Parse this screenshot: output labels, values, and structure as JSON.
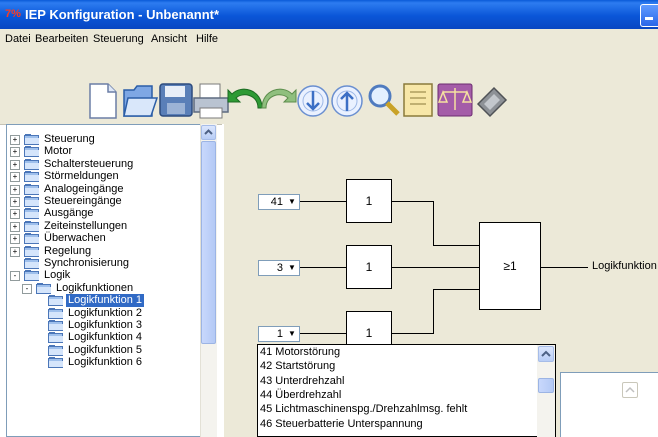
{
  "window": {
    "title": "IEP Konfiguration - Unbenannt*",
    "app_icon_text": "7%",
    "colors": {
      "titlebar": "#0a56d8",
      "selection": "#316ac5",
      "workspace": "#ece9d8"
    }
  },
  "menubar": {
    "items": [
      "Datei",
      "Bearbeiten",
      "Steuerung",
      "Ansicht",
      "Hilfe"
    ]
  },
  "toolbar": {
    "buttons": [
      {
        "icon": "new-document-icon"
      },
      {
        "icon": "open-folder-icon"
      },
      {
        "icon": "save-disk-icon"
      },
      {
        "icon": "print-icon"
      },
      {
        "icon": "undo-arrow-icon"
      },
      {
        "icon": "redo-arrow-icon"
      },
      {
        "icon": "download-arrow-icon"
      },
      {
        "icon": "upload-arrow-icon"
      },
      {
        "icon": "search-magnifier-icon"
      },
      {
        "icon": "notebook-icon"
      },
      {
        "icon": "scales-icon"
      },
      {
        "icon": "device-icon"
      }
    ]
  },
  "tree": {
    "items": [
      {
        "label": "Steuerung",
        "level": 0,
        "expander": "+"
      },
      {
        "label": "Motor",
        "level": 0,
        "expander": "+"
      },
      {
        "label": "Schaltersteuerung",
        "level": 0,
        "expander": "+"
      },
      {
        "label": "Störmeldungen",
        "level": 0,
        "expander": "+"
      },
      {
        "label": "Analogeingänge",
        "level": 0,
        "expander": "+"
      },
      {
        "label": "Steuereingänge",
        "level": 0,
        "expander": "+"
      },
      {
        "label": "Ausgänge",
        "level": 0,
        "expander": "+"
      },
      {
        "label": "Zeiteinstellungen",
        "level": 0,
        "expander": "+"
      },
      {
        "label": "Überwachen",
        "level": 0,
        "expander": "+"
      },
      {
        "label": "Regelung",
        "level": 0,
        "expander": "+"
      },
      {
        "label": "Synchronisierung",
        "level": 0,
        "expander": ""
      },
      {
        "label": "Logik",
        "level": 0,
        "expander": "-"
      },
      {
        "label": "Logikfunktionen",
        "level": 1,
        "expander": "-"
      },
      {
        "label": "Logikfunktion 1",
        "level": 2,
        "expander": "",
        "selected": true
      },
      {
        "label": "Logikfunktion 2",
        "level": 2,
        "expander": ""
      },
      {
        "label": "Logikfunktion 3",
        "level": 2,
        "expander": ""
      },
      {
        "label": "Logikfunktion 4",
        "level": 2,
        "expander": ""
      },
      {
        "label": "Logikfunktion 5",
        "level": 2,
        "expander": ""
      },
      {
        "label": "Logikfunktion 6",
        "level": 2,
        "expander": ""
      }
    ]
  },
  "logic": {
    "inputs": [
      {
        "value": "41",
        "block": "1"
      },
      {
        "value": "3",
        "block": "1"
      },
      {
        "value": "1",
        "block": "1"
      }
    ],
    "or_gate": "≥1",
    "output_label": "Logikfunktion"
  },
  "dropdown": {
    "options": [
      "41 Motorstörung",
      "42 Startstörung",
      "43 Unterdrehzahl",
      "44 Überdrehzahl",
      "45 Lichtmaschinenspg./Drehzahlmsg. fehlt",
      "46 Steuerbatterie Unterspannung"
    ]
  }
}
